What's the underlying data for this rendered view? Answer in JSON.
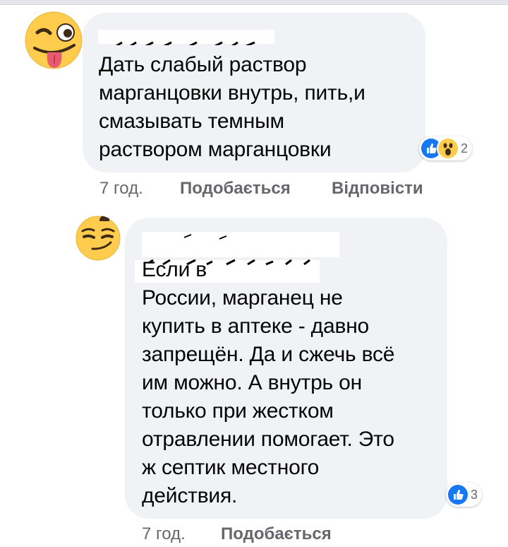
{
  "comments": [
    {
      "avatar_icon": "winking-tongue-emoji-icon",
      "text": "Дать слабый раствор\nмарганцовки внутрь, пить,и\nсмазывать темным\nраствором марганцовки",
      "reactions": {
        "icons": [
          "like-icon",
          "wow-icon"
        ],
        "count": "2"
      },
      "time": "7 год.",
      "like_label": "Подобається",
      "reply_label": "Відповісти"
    },
    {
      "avatar_icon": "smirking-emoji-icon",
      "text": "Если в\nРоссии, марганец не\nкупить в аптеке - давно\nзапрещён. Да и сжечь всё\nим можно. А внутрь он\nтолько при жестком\nотравлении помогает. Это\nж септик местного\nдействия.",
      "reactions": {
        "icons": [
          "like-icon"
        ],
        "count": "3"
      },
      "time": "7 год.",
      "like_label": "Подобається"
    }
  ],
  "colors": {
    "bubble": "#f0f2f5",
    "meta_text": "#65676b",
    "like_blue": "#1877f2",
    "emoji_yellow": "#ffcc4d"
  }
}
